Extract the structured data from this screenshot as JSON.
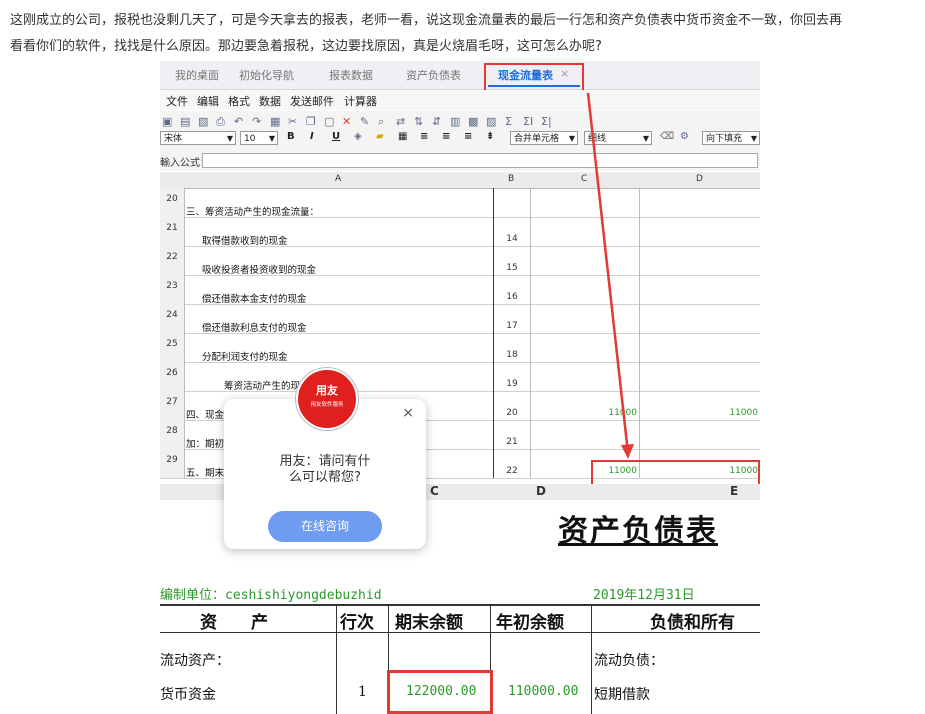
{
  "question": {
    "line1": "这刚成立的公司，报税也没剩几天了，可是今天拿去的报表，老师一看，说这现金流量表的最后一行怎和资产负债表中货币资金不一致，你回去再",
    "line2": "看看你们的软件，找找是什么原因。那边要急着报税，这边要找原因，真是火烧眉毛呀，这可怎么办呢?"
  },
  "tabs": [
    "我的桌面",
    "初始化导航",
    "报表数据",
    "资产负债表",
    "现金流量表"
  ],
  "active_tab_close": "×",
  "menu": [
    "文件",
    "编辑",
    "格式",
    "数据",
    "发送邮件",
    "计算器"
  ],
  "toolbar": {
    "font_name": "宋体",
    "font_size": "10",
    "bold": "B",
    "italic": "I",
    "underline": "U",
    "merge": "合并单元格",
    "border": "细线",
    "fill": "向下填充",
    "sigma1": "Σ",
    "sigma2": "ΣI",
    "sigma3": "Σ|"
  },
  "formula_label": "輸入公式：",
  "columns": [
    "A",
    "B",
    "C",
    "D"
  ],
  "rows": [
    {
      "num": "20",
      "a": "三、筹资活动产生的现金流量：",
      "b": "",
      "c": "",
      "d": ""
    },
    {
      "num": "21",
      "a": "取得借款收到的现金",
      "b": "14",
      "c": "",
      "d": ""
    },
    {
      "num": "22",
      "a": "吸收投资者投资收到的现金",
      "b": "15",
      "c": "",
      "d": ""
    },
    {
      "num": "23",
      "a": "偿还借款本金支付的现金",
      "b": "16",
      "c": "",
      "d": ""
    },
    {
      "num": "24",
      "a": "偿还借款利息支付的现金",
      "b": "17",
      "c": "",
      "d": ""
    },
    {
      "num": "25",
      "a": "分配利润支付的现金",
      "b": "18",
      "c": "",
      "d": ""
    },
    {
      "num": "26",
      "a": "筹资活动产生的现",
      "b": "19",
      "c": "",
      "d": ""
    },
    {
      "num": "27",
      "a": "四、现金",
      "b": "20",
      "c": "11000",
      "d": "11000"
    },
    {
      "num": "28",
      "a": "加：期初",
      "b": "21",
      "c": "",
      "d": ""
    },
    {
      "num": "29",
      "a": "五、期末",
      "b": "22",
      "c": "11000",
      "d": "11000"
    }
  ],
  "balance_sheet": {
    "columns": [
      "C",
      "D",
      "E"
    ],
    "title": "资产负债表",
    "unit": "编制单位：ceshishiyongdebuzhid",
    "date": "2019年12月31日",
    "headers": [
      "资　　产",
      "行次",
      "期末余额",
      "年初余额",
      "负债和所有"
    ],
    "section_left": "流动资产：",
    "section_right": "流动负债：",
    "item": "货币资金",
    "item_line": "1",
    "item_end": "122000.00",
    "item_begin": "110000.00",
    "item_right": "短期借款"
  },
  "chat_popup": {
    "logo_big": "用友",
    "logo_small": "用友软件服务",
    "message_line1": "用友：请问有什",
    "message_line2": "么可以帮您?",
    "button": "在线咨询",
    "close": "×"
  },
  "colors": {
    "highlight": "#e53935",
    "accent": "#1e6ee0",
    "value_green": "#2a9a2a",
    "button": "#6f9bf0"
  }
}
